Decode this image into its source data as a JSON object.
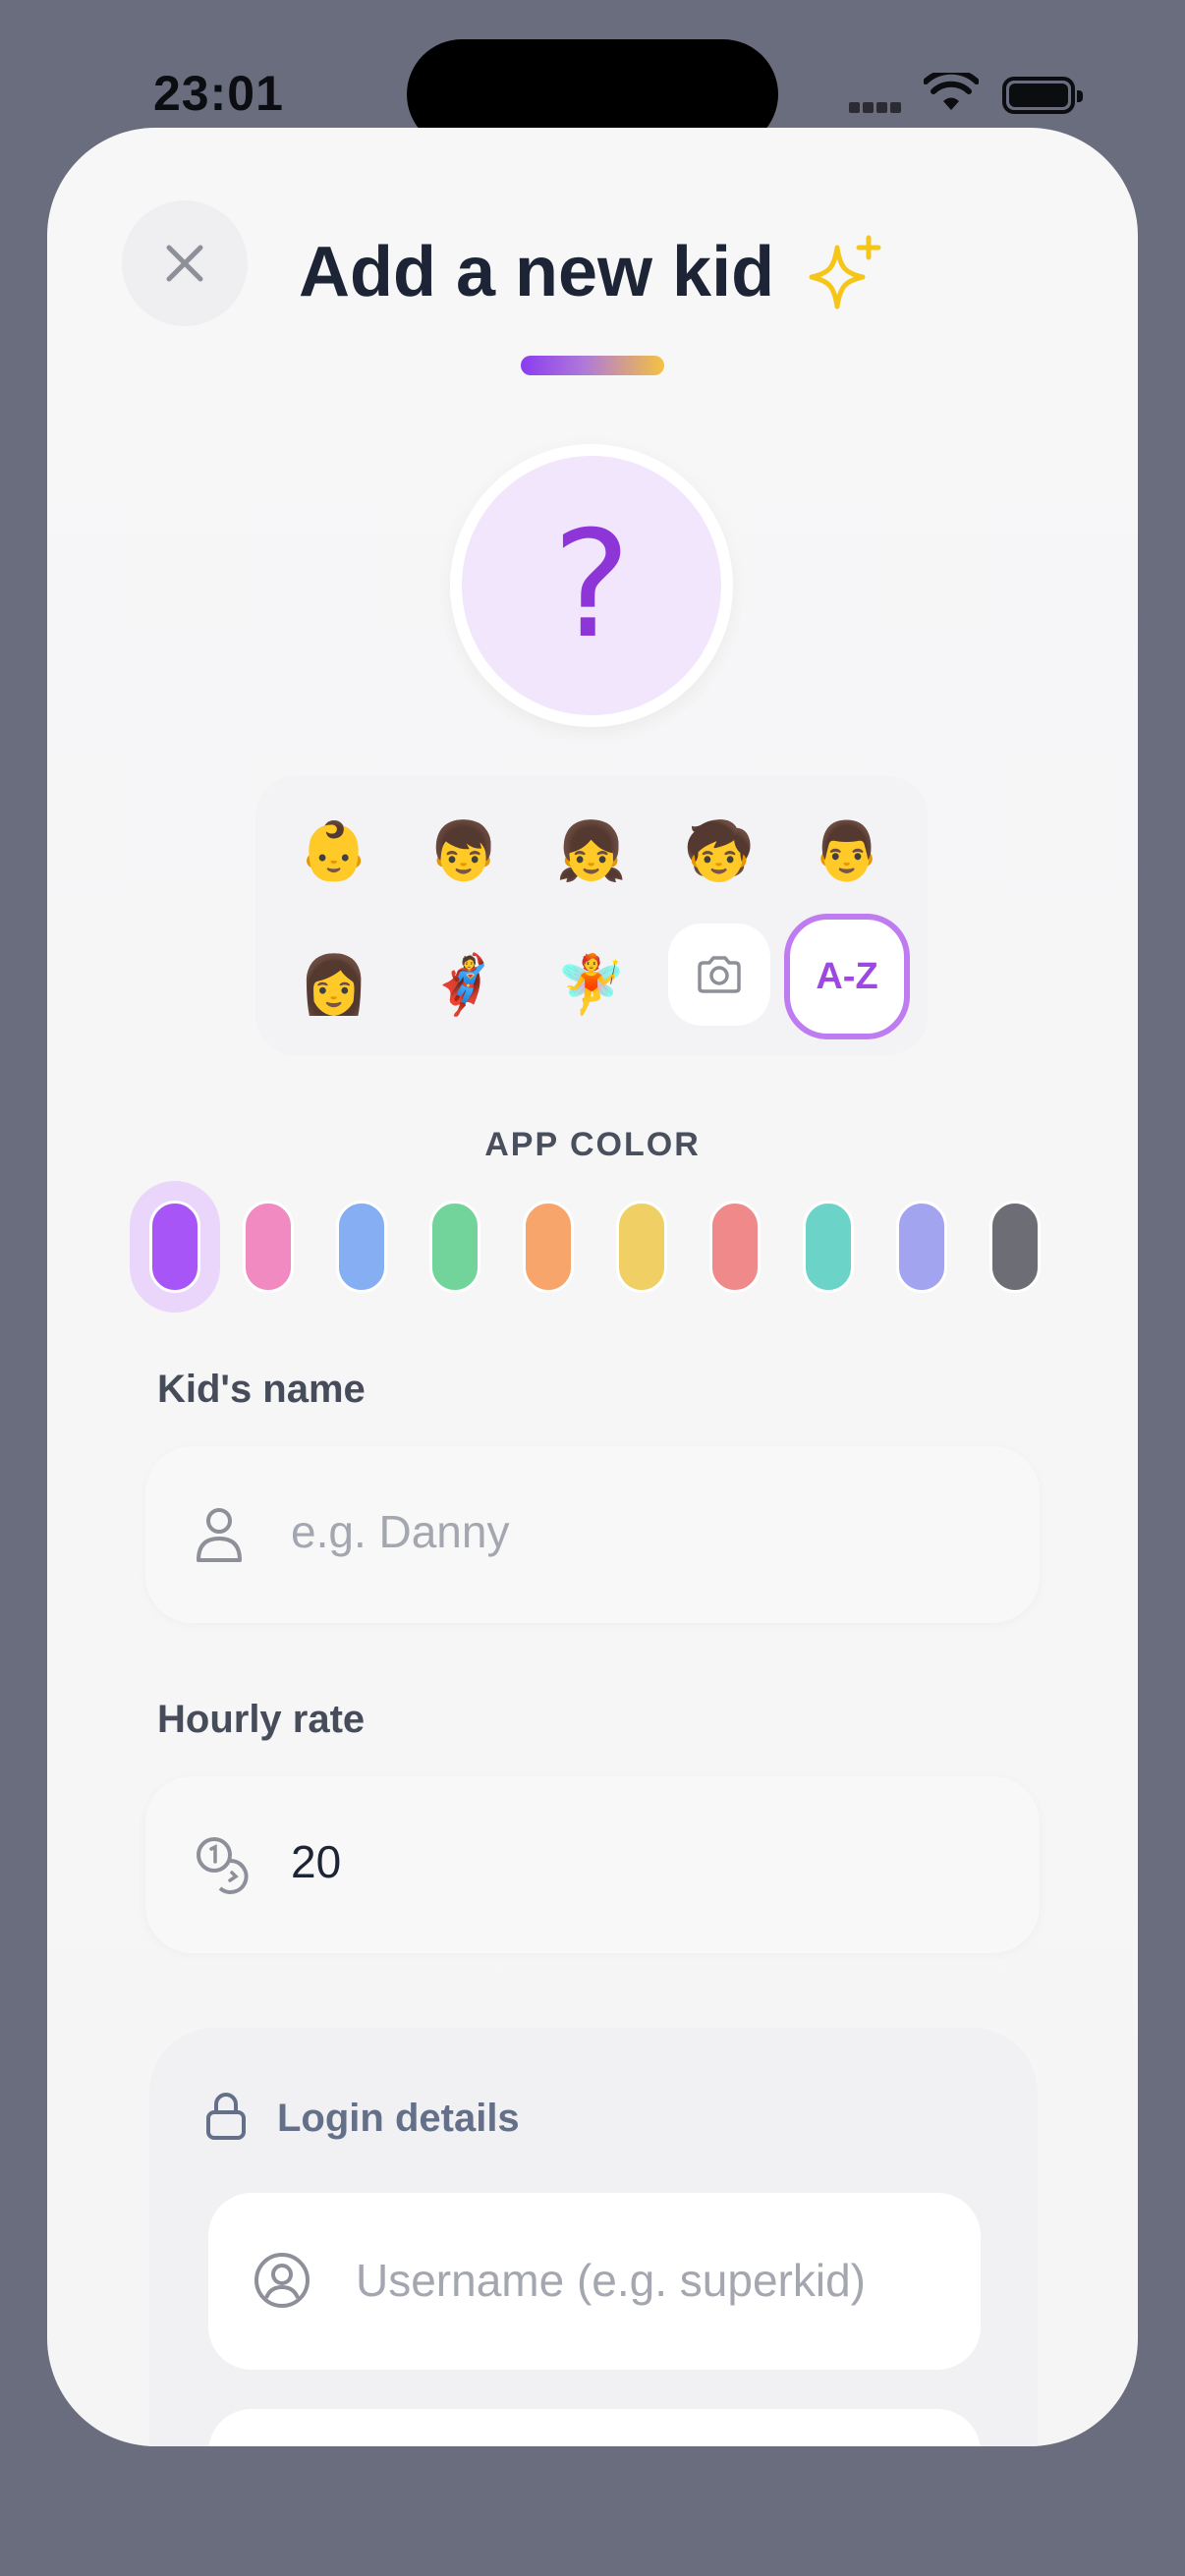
{
  "status_bar": {
    "time": "23:01"
  },
  "header": {
    "title": "Add a new kid",
    "sparkle_icon": "sparkles-icon",
    "close_icon": "close-icon"
  },
  "avatar": {
    "placeholder": "?"
  },
  "avatar_options": {
    "emojis": [
      "👶",
      "👦",
      "👧",
      "🧒",
      "👨",
      "👩",
      "🦸",
      "🧚"
    ],
    "camera_icon": "camera-icon",
    "az_label": "A-Z"
  },
  "app_color": {
    "label": "APP COLOR",
    "selected_index": 0,
    "swatches": [
      "#a855f7",
      "#f08ac0",
      "#86aef2",
      "#72d49a",
      "#f7a56a",
      "#f0cf64",
      "#f08a8a",
      "#6cd3c8",
      "#a3a4f0",
      "#6d6e75"
    ]
  },
  "name_field": {
    "label": "Kid's name",
    "placeholder": "e.g. Danny",
    "icon": "person-icon"
  },
  "rate_field": {
    "label": "Hourly rate",
    "value": "20",
    "icon": "coins-icon"
  },
  "login": {
    "title": "Login details",
    "lock_icon": "lock-icon",
    "username_placeholder": "Username (e.g. superkid)",
    "username_icon": "user-circle-icon"
  }
}
